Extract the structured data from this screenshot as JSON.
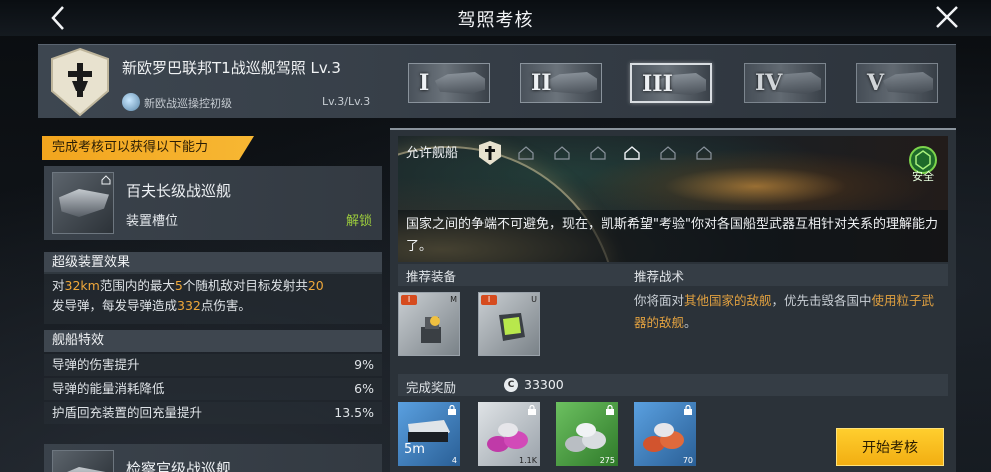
{
  "header": {
    "title": "驾照考核",
    "back_icon": "chevron-left-icon",
    "close_icon": "close-icon"
  },
  "license": {
    "title": "新欧罗巴联邦T1战巡舰驾照 Lv.3",
    "subtitle": "新欧战巡操控初级",
    "level": "Lv.3/Lv.3",
    "tiers": [
      "I",
      "II",
      "III",
      "IV",
      "V"
    ],
    "active_tier": "III"
  },
  "left": {
    "gain_banner": "完成考核可以获得以下能力",
    "ship1": {
      "name": "百夫长级战巡舰",
      "slot": "装置槽位",
      "status": "解锁"
    },
    "super_device": {
      "heading": "超级装置效果",
      "desc": {
        "p1": "对",
        "range": "32km",
        "p2": "范围内的最大",
        "count": "5",
        "p3": "个随机敌对目标发射共",
        "shots": "20",
        "p4": "发导弹，每发导弹造成",
        "damage": "332",
        "p5": "点伤害。"
      }
    },
    "traits": {
      "heading": "舰船特效",
      "rows": [
        {
          "label": "导弹的伤害提升",
          "value": "9%"
        },
        {
          "label": "导弹的能量消耗降低",
          "value": "6%"
        },
        {
          "label": "护盾回充装置的回充量提升",
          "value": "13.5%"
        }
      ]
    },
    "ship2": {
      "name": "检察官级战巡舰"
    }
  },
  "right": {
    "allowed_label": "允许舰船",
    "safe_label": "安全",
    "description": "国家之间的争端不可避免，现在，凯斯希望\"考验\"你对各国船型武器互相针对关系的理解能力了。",
    "rec_equip_label": "推荐装备",
    "rec_tactic_label": "推荐战术",
    "equipment": [
      {
        "badge": "I",
        "corner": "M"
      },
      {
        "badge": "I",
        "corner": "U"
      }
    ],
    "tactic": {
      "p1": "你将面对",
      "hl1": "其他国家的敌舰",
      "p2": "，优先击毁各国中",
      "hl2": "使用粒子武器的敌舰",
      "p3": "。"
    },
    "reward_label": "完成奖励",
    "credit_symbol": "C",
    "credits": "33300",
    "rewards": [
      {
        "color": "#3d7fc1",
        "count": "4",
        "text": "5m"
      },
      {
        "color": "#c9ced2",
        "count": "1.1K"
      },
      {
        "color": "#4fa84a",
        "count": "275"
      },
      {
        "color": "#3d7fc1",
        "count": "70"
      }
    ],
    "start_button": "开始考核"
  },
  "colors": {
    "accent_orange": "#f2a51e",
    "unlock_green": "#9ccc3c",
    "highlight": "#f0a83a",
    "start_button": "#ffce2e"
  }
}
